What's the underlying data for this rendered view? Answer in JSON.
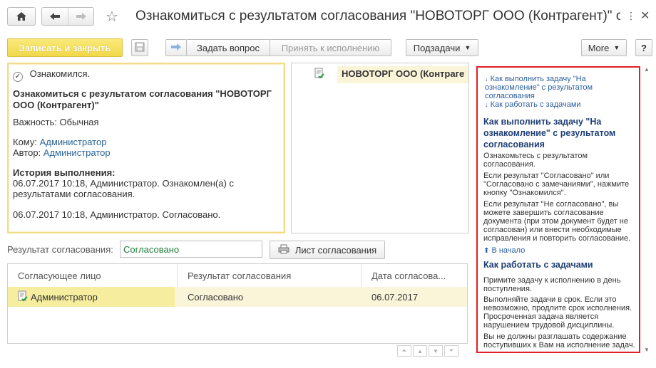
{
  "titlebar": {
    "title": "Ознакомиться с результатом согласования \"НОВОТОРГ ООО (Контрагент)\" от..."
  },
  "toolbar": {
    "save_close_label": "Записать и закрыть",
    "ask_question_label": "Задать вопрос",
    "accept_label": "Принять к исполнению",
    "subtasks_label": "Подзадачи",
    "more_label": "More"
  },
  "task": {
    "status": "Ознакомился.",
    "heading": "Ознакомиться с результатом согласования \"НОВОТОРГ ООО (Контрагент)\"",
    "importance": "Важность: Обычная",
    "to_label": "Кому:",
    "to_value": "Администратор",
    "author_label": "Автор:",
    "author_value": "Администратор",
    "history_heading": "История выполнения:",
    "history_1a": "06.07.2017 10:18, Администратор. Ознакомлен(а) с",
    "history_1b": "результатами согласования.",
    "history_2": "06.07.2017 10:18, Администратор. Согласовано."
  },
  "subject": {
    "name": "НОВОТОРГ ООО  (Контраге"
  },
  "result": {
    "label": "Результат согласования:",
    "value": "Согласовано",
    "sheet_button": "Лист согласования"
  },
  "table": {
    "headers": [
      "Согласующее лицо",
      "Результат согласования",
      "Дата согласова..."
    ],
    "rows": [
      {
        "person": "Администратор",
        "result": "Согласовано",
        "date": "06.07.2017"
      }
    ]
  },
  "help": {
    "link1": "Как выполнить задачу \"На ознакомление\" с результатом согласования",
    "link2": "Как работать с задачами",
    "h1": "Как выполнить задачу \"На ознакомление\" с результатом согласования",
    "p1": "Ознакомьтесь с результатом согласования.",
    "p2": "Если результат \"Согласовано\" или \"Согласовано с замечаниями\", нажмите кнопку \"Ознакомился\".",
    "p3": "Если результат \"Не согласовано\", вы можете завершить согласование документа (при этом документ будет не согласован) или внести необходимые исправления и повторить согласование.",
    "to_top": "В начало",
    "h2": "Как работать с задачами",
    "p4": "Примите задачу к исполнению в день поступления.",
    "p5": "Выполняйте задачи в срок. Если это невозможно, продлите срок исполнения. Просроченная задача является нарушением трудовой дисциплины.",
    "p6": "Вы не должны разглашать содержание поступивших к Вам на исполнение задач."
  },
  "colors": {
    "accent_yellow": "#f5df5a",
    "help_border": "#e01f26",
    "link": "#2a6496"
  }
}
